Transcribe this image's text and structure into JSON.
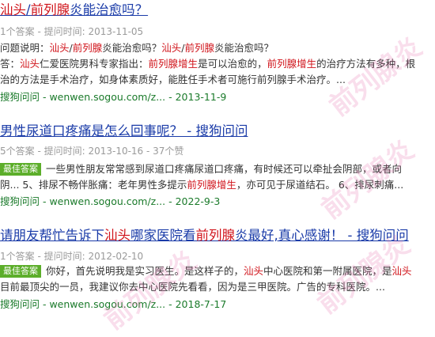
{
  "results": [
    {
      "title_parts": [
        {
          "t": "汕头",
          "hl": true
        },
        {
          "t": "/",
          "hl": false
        },
        {
          "t": "前列腺",
          "hl": true
        },
        {
          "t": "炎能治愈吗？",
          "hl": false
        }
      ],
      "meta": "1个答案 - 提问时间: 2013-11-05",
      "question_label": "问题说明：",
      "question_parts": [
        {
          "t": "汕头",
          "hl": true
        },
        {
          "t": "/",
          "hl": false
        },
        {
          "t": "前列腺",
          "hl": true
        },
        {
          "t": "炎能治愈吗？",
          "hl": false
        },
        {
          "t": "汕头",
          "hl": true
        },
        {
          "t": "/",
          "hl": false
        },
        {
          "t": "前列腺",
          "hl": true
        },
        {
          "t": "炎能治愈吗？",
          "hl": false
        }
      ],
      "answer_label": "答：",
      "answer_line1": [
        {
          "t": "汕头",
          "hl": true
        },
        {
          "t": "仁爱医院男科专家指出：",
          "hl": false
        },
        {
          "t": "前列腺增生",
          "hl": true
        },
        {
          "t": "是可以治愈的，",
          "hl": false
        },
        {
          "t": "前列腺增生",
          "hl": true
        },
        {
          "t": "的治疗方法有多种，根",
          "hl": false
        }
      ],
      "answer_line2": [
        {
          "t": "治的方法是手术治疗，如身体素质好，能胜任手术者可施行前列腺手术治疗。...",
          "hl": false
        }
      ],
      "source": "搜狗问问 - wenwen.sogou.com/z...",
      "date": "- 2013-11-9"
    },
    {
      "title_parts": [
        {
          "t": "男性尿道口疼痛是怎么回事呢？ - 搜狗问问",
          "hl": false
        }
      ],
      "meta": "5个答案 - 提问时间: 2013-10-16 - 37个赞",
      "badge": "最佳答案",
      "answer_line1": [
        {
          "t": "一些男性朋友常常感到尿道口疼痛尿道口疼痛，有时候还可以牵扯会阴部，或者向",
          "hl": false
        }
      ],
      "answer_line2": [
        {
          "t": "阴... 5、排尿不畅伴胀痛：老年男性多提示",
          "hl": false
        },
        {
          "t": "前列腺增生",
          "hl": true
        },
        {
          "t": "，亦可见于尿道结石。 6、排尿刺痛...",
          "hl": false
        }
      ],
      "source": "搜狗问问 - wenwen.sogou.com/z...",
      "date": "- 2022-9-3"
    },
    {
      "title_parts": [
        {
          "t": "请朋友帮忙告诉下",
          "hl": false
        },
        {
          "t": "汕头",
          "hl": true
        },
        {
          "t": "哪家医院看",
          "hl": false
        },
        {
          "t": "前列腺",
          "hl": true
        },
        {
          "t": "炎最好,真心感谢！ - 搜狗问问",
          "hl": false
        }
      ],
      "meta": "1个答案 - 提问时间: 2012-02-10",
      "badge": "最佳答案",
      "answer_line1": [
        {
          "t": "你好，首先说明我是实习医生。是这样子的，",
          "hl": false
        },
        {
          "t": "汕头",
          "hl": true
        },
        {
          "t": "中心医院和第一附属医院，是",
          "hl": false
        },
        {
          "t": "汕头",
          "hl": true
        }
      ],
      "answer_line2": [
        {
          "t": "目前最顶尖的一员，我建议你去中心医院先看看，因为是三甲医院。广告的专科医院。...",
          "hl": false
        }
      ],
      "source": "搜狗问问 - wenwen.sogou.com/z...",
      "date": "- 2018-7-17"
    }
  ],
  "watermark_text": "前列腺炎",
  "colors": {
    "title": "#1a3ba8",
    "highlight": "#d0131a",
    "meta": "#9a9a9a",
    "source": "#1a7a2a",
    "badge": "#5cae2a",
    "watermark": "#e26aaa"
  }
}
